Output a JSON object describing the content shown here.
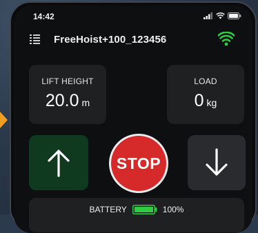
{
  "status_bar": {
    "time": "14:42",
    "icons": [
      "signal-icon",
      "wifi-icon",
      "battery-icon"
    ]
  },
  "header": {
    "menu_icon": "list-icon",
    "device_name": "FreeHoist+100_123456",
    "connection_icon": "wifi-icon",
    "connection_color": "#2ecc40"
  },
  "metrics": {
    "lift_height": {
      "label": "LIFT HEIGHT",
      "value": "20.0",
      "unit": "m"
    },
    "load": {
      "label": "LOAD",
      "value": "0",
      "unit": "kg"
    }
  },
  "controls": {
    "up": {
      "icon": "arrow-up-icon",
      "color": "#0f3a1f"
    },
    "stop": {
      "label": "STOP",
      "color": "#d62a2a"
    },
    "down": {
      "icon": "arrow-down-icon",
      "color": "#2a2b2e"
    }
  },
  "battery": {
    "label": "BATTERY",
    "level": 1.0,
    "percent_text": "100%",
    "color": "#2ecc40"
  }
}
